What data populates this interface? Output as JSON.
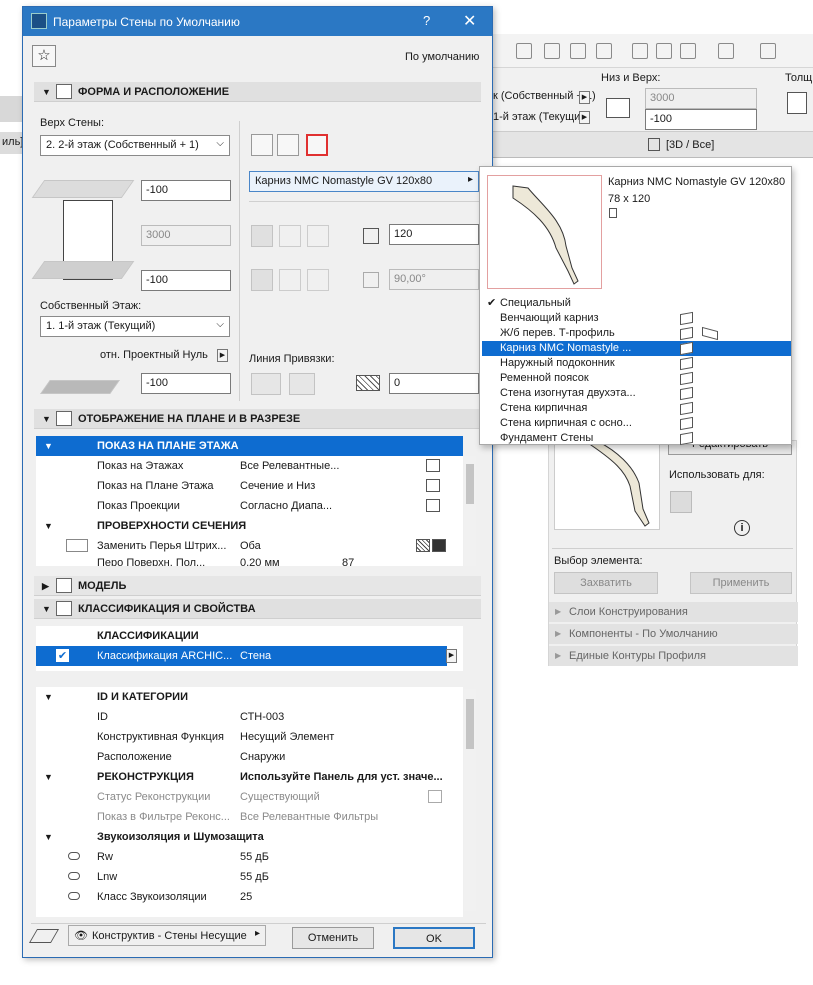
{
  "background_app": {
    "left_strip_label": "иль]",
    "niz_verh_label": "Низ и Верх:",
    "field_top": "3000",
    "field_bottom": "-100",
    "story_top": "к (Собственный + 1)",
    "story_bottom": "1-й этаж (Текущий)",
    "top_right_label": "Толщи",
    "view_tab": "[3D / Все]"
  },
  "dialog": {
    "title": "Параметры Стены по Умолчанию",
    "help": "?",
    "close": "✕",
    "favorites_default": "По умолчанию",
    "ok": "OK",
    "cancel": "Отменить",
    "footer_layer": "Конструктив - Стены Несущие",
    "sections": {
      "shape": "ФОРМА И РАСПОЛОЖЕНИЕ",
      "plan": "ОТОБРАЖЕНИЕ НА ПЛАНЕ И В РАЗРЕЗЕ",
      "model": "МОДЕЛЬ",
      "classification": "КЛАССИФИКАЦИЯ И СВОЙСТВА"
    },
    "shape": {
      "top_label": "Верх Стены:",
      "top_value": "2. 2-й этаж (Собственный + 1)",
      "offset_top": "-100",
      "height": "3000",
      "offset_bottom": "-100",
      "home_story_label": "Собственный Этаж:",
      "home_story_value": "1. 1-й этаж (Текущий)",
      "ref_label": "отн. Проектный Нуль",
      "ref_value": "-100",
      "profile_value": "Карниз NMC Nomastyle GV 120x80",
      "thickness": "120",
      "angle": "90,00°",
      "ref_line_label": "Линия Привязки:",
      "ref_line_offset": "0"
    },
    "plan_tree": [
      {
        "type": "header",
        "c1": "ПОКАЗ НА ПЛАНЕ ЭТАЖА",
        "selected": true
      },
      {
        "type": "row",
        "c1": "Показ на Этажах",
        "c2": "Все Релевантные..."
      },
      {
        "type": "row",
        "c1": "Показ на Плане Этажа",
        "c2": "Сечение и Низ"
      },
      {
        "type": "row",
        "c1": "Показ Проекции",
        "c2": "Согласно Диапа..."
      },
      {
        "type": "header",
        "c1": "ПРОВЕРХНОСТИ СЕЧЕНИЯ"
      },
      {
        "type": "row",
        "c1": "Заменить Перья Штрих...",
        "c2": "Оба"
      },
      {
        "type": "row",
        "c1": "Перо Поверхн. Пол...",
        "c2": "0,20 мм",
        "c3": "87"
      }
    ],
    "class_tree": [
      {
        "type": "header",
        "c1": "КЛАССИФИКАЦИИ"
      },
      {
        "type": "row",
        "c1": "Классификация ARCHIC...",
        "c2": "Стена",
        "selected": true
      }
    ],
    "prop_tree": [
      {
        "type": "header",
        "c1": "ID И КАТЕГОРИИ"
      },
      {
        "type": "row",
        "c1": "ID",
        "c2": "СТН-003"
      },
      {
        "type": "row",
        "c1": "Конструктивная Функция",
        "c2": "Несущий Элемент"
      },
      {
        "type": "row",
        "c1": "Расположение",
        "c2": "Снаружи"
      },
      {
        "type": "header",
        "c1": "РЕКОНСТРУКЦИЯ",
        "c2": "Используйте Панель для уст. значе..."
      },
      {
        "type": "row",
        "c1": "Статус Реконструкции",
        "c2": "Существующий",
        "gray": true
      },
      {
        "type": "row",
        "c1": "Показ в Фильтре Реконс...",
        "c2": "Все Релевантные Фильтры",
        "gray": true
      },
      {
        "type": "header",
        "c1": "Звукоизоляция и Шумозащита"
      },
      {
        "type": "row",
        "c1": "Rw",
        "c2": "55 дБ"
      },
      {
        "type": "row",
        "c1": "Lnw",
        "c2": "55 дБ"
      },
      {
        "type": "row",
        "c1": "Класс Звукоизоляции",
        "c2": "25"
      }
    ]
  },
  "popup": {
    "preview_name": "Карниз NMC Nomastyle GV 120x80",
    "preview_size": "78 x 120",
    "items": [
      {
        "label": "Специальный",
        "checked": true
      },
      {
        "label": "Венчающий карниз"
      },
      {
        "label": "Ж/б перев. Т-профиль"
      },
      {
        "label": "Карниз NMC Nomastyle ...",
        "selected": true
      },
      {
        "label": "Наружный подоконник"
      },
      {
        "label": "Ременной поясок"
      },
      {
        "label": "Стена изогнутая двухэта..."
      },
      {
        "label": "Стена кирпичная"
      },
      {
        "label": "Стена кирпичная с осно..."
      },
      {
        "label": "Фундамент Стены"
      }
    ]
  },
  "profile_panel": {
    "edit_button": "Редактировать",
    "use_for_label": "Использовать для:",
    "pick_label": "Выбор элемента:",
    "capture_button": "Захватить",
    "apply_button": "Применить",
    "collapsed": [
      "Слои Конструирования",
      "Компоненты - По Умолчанию",
      "Единые Контуры Профиля"
    ]
  }
}
